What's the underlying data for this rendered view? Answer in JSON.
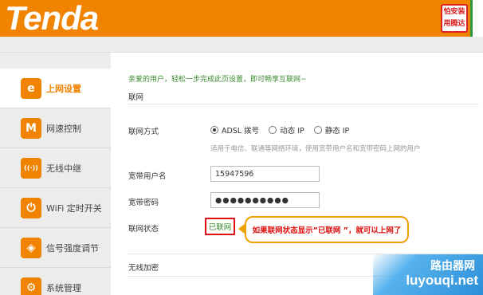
{
  "header": {
    "logo": "Tenda",
    "badge_line1": "怕安装",
    "badge_line2": "用腾达"
  },
  "sidebar": {
    "items": [
      {
        "label": "上网设置",
        "icon": "internet-explorer-icon",
        "glyph": "e",
        "active": true
      },
      {
        "label": "网速控制",
        "icon": "speed-wave-icon",
        "glyph": "M"
      },
      {
        "label": "无线中继",
        "icon": "wireless-repeater-icon",
        "glyph": "((·))"
      },
      {
        "label": "WiFi 定时开关",
        "icon": "power-timer-icon",
        "glyph": "⏻"
      },
      {
        "label": "信号强度调节",
        "icon": "signal-shield-icon",
        "glyph": "◈"
      },
      {
        "label": "系统管理",
        "icon": "gear-icon",
        "glyph": "⚙"
      }
    ]
  },
  "main": {
    "welcome": "亲爱的用户，轻松一步完成此页设置，即可畅享互联网~",
    "section_internet": "联网",
    "connection_type_label": "联网方式",
    "connection_options": [
      "ADSL 拨号",
      "动态 IP",
      "静态 IP"
    ],
    "connection_selected": "ADSL 拨号",
    "hint": "适用于电信、联通等网络环境，使用宽带用户名和宽带密码上网的用户",
    "username_label": "宽带用户名",
    "username_value": "15947596",
    "password_label": "宽带密码",
    "password_value": "●●●●●●●●●●",
    "status_label": "联网状态",
    "status_value": "已联网",
    "section_wireless": "无线加密"
  },
  "annotation": {
    "callout": "如果联网状态显示”已联网 ”，就可以上网了"
  },
  "watermark": {
    "line1": "路由器网",
    "line2": "luyouqi.net"
  },
  "colors": {
    "brand_orange": "#f08300",
    "status_green": "#3a8a2e",
    "highlight_red": "#e01010"
  }
}
